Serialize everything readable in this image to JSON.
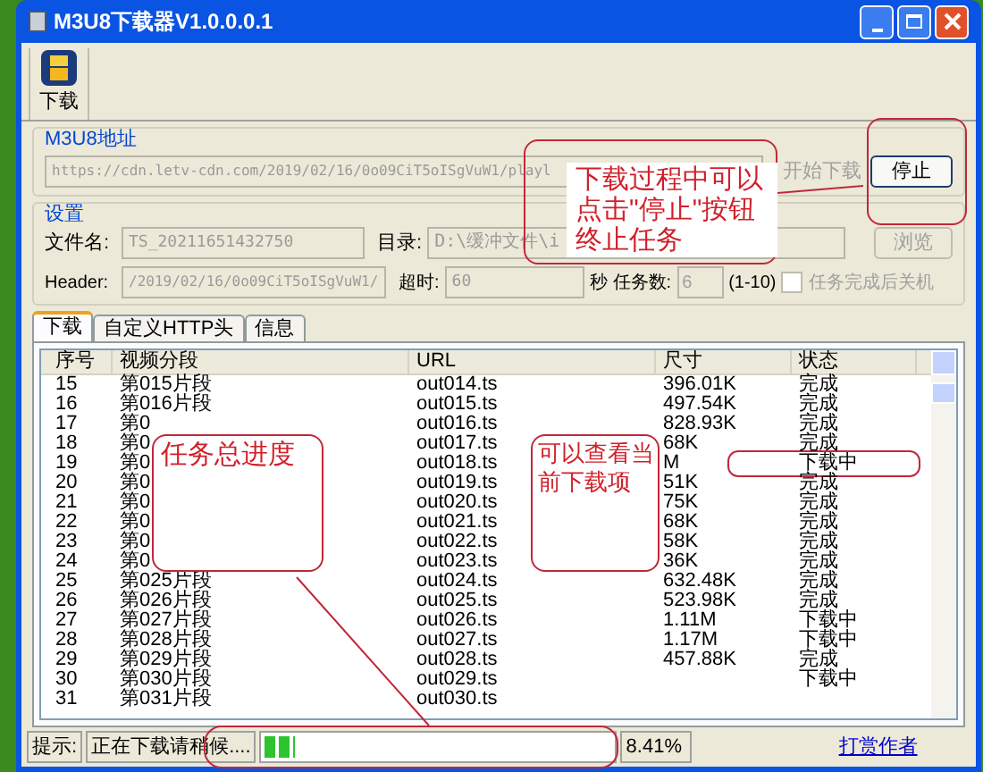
{
  "window": {
    "title": "M3U8下载器V1.0.0.0.1"
  },
  "toolbar": {
    "items": [
      {
        "label": "下载"
      }
    ]
  },
  "address_group": {
    "title": "M3U8地址",
    "url": "https://cdn.letv-cdn.com/2019/02/16/0o09CiT5oISgVuW1/playl",
    "start_button": {
      "label": "开始下载",
      "disabled": true
    },
    "stop_button": {
      "label": "停止",
      "disabled": false
    }
  },
  "settings_group": {
    "title": "设置",
    "filename_label": "文件名:",
    "filename": "TS_20211651432750",
    "dir_label": "目录:",
    "dir": "D:\\缓冲文件\\i",
    "browse_button": "浏览",
    "header_label": "Header:",
    "header": "/2019/02/16/0o09CiT5oISgVuW1/",
    "timeout_label": "超时:",
    "timeout": "60",
    "seconds_label": "秒",
    "tasks_label": "任务数:",
    "tasks": "6",
    "tasks_range": "(1-10)",
    "shutdown": {
      "label": "任务完成后关机",
      "checked": false
    }
  },
  "tabs": [
    {
      "label": "下载",
      "selected": true
    },
    {
      "label": "自定义HTTP头",
      "selected": false
    },
    {
      "label": "信息",
      "selected": false
    }
  ],
  "table": {
    "columns": [
      "序号",
      "视频分段",
      "URL",
      "尺寸",
      "状态"
    ],
    "rows": [
      [
        "15",
        "第015片段",
        "out014.ts",
        "396.01K",
        "完成"
      ],
      [
        "16",
        "第016片段",
        "out015.ts",
        "497.54K",
        "完成"
      ],
      [
        "17",
        "第0",
        "out016.ts",
        "828.93K",
        "完成"
      ],
      [
        "18",
        "第0",
        "out017.ts",
        "68K",
        "完成"
      ],
      [
        "19",
        "第0",
        "out018.ts",
        "M",
        "下载中"
      ],
      [
        "20",
        "第0",
        "out019.ts",
        "51K",
        "完成"
      ],
      [
        "21",
        "第0",
        "out020.ts",
        "75K",
        "完成"
      ],
      [
        "22",
        "第0",
        "out021.ts",
        "68K",
        "完成"
      ],
      [
        "23",
        "第0",
        "out022.ts",
        "58K",
        "完成"
      ],
      [
        "24",
        "第0",
        "out023.ts",
        "36K",
        "完成"
      ],
      [
        "25",
        "第025片段",
        "out024.ts",
        "632.48K",
        "完成"
      ],
      [
        "26",
        "第026片段",
        "out025.ts",
        "523.98K",
        "完成"
      ],
      [
        "27",
        "第027片段",
        "out026.ts",
        "1.11M",
        "下载中"
      ],
      [
        "28",
        "第028片段",
        "out027.ts",
        "1.17M",
        "下载中"
      ],
      [
        "29",
        "第029片段",
        "out028.ts",
        "457.88K",
        "完成"
      ],
      [
        "30",
        "第030片段",
        "out029.ts",
        "",
        "下载中"
      ],
      [
        "31",
        "第031片段",
        "out030.ts",
        "",
        ""
      ]
    ]
  },
  "status_bar": {
    "hint_label": "提示:",
    "hint": "正在下载请稍候....",
    "progress": {
      "level": 0.0841,
      "reading": "8.41%"
    },
    "link": "打赏作者"
  },
  "callouts": [
    {
      "text": "下载过程中可以点击\"停止\"按钮终止任务"
    },
    {
      "text": "任务总进度"
    },
    {
      "text": "可以查看当前下载项"
    }
  ]
}
